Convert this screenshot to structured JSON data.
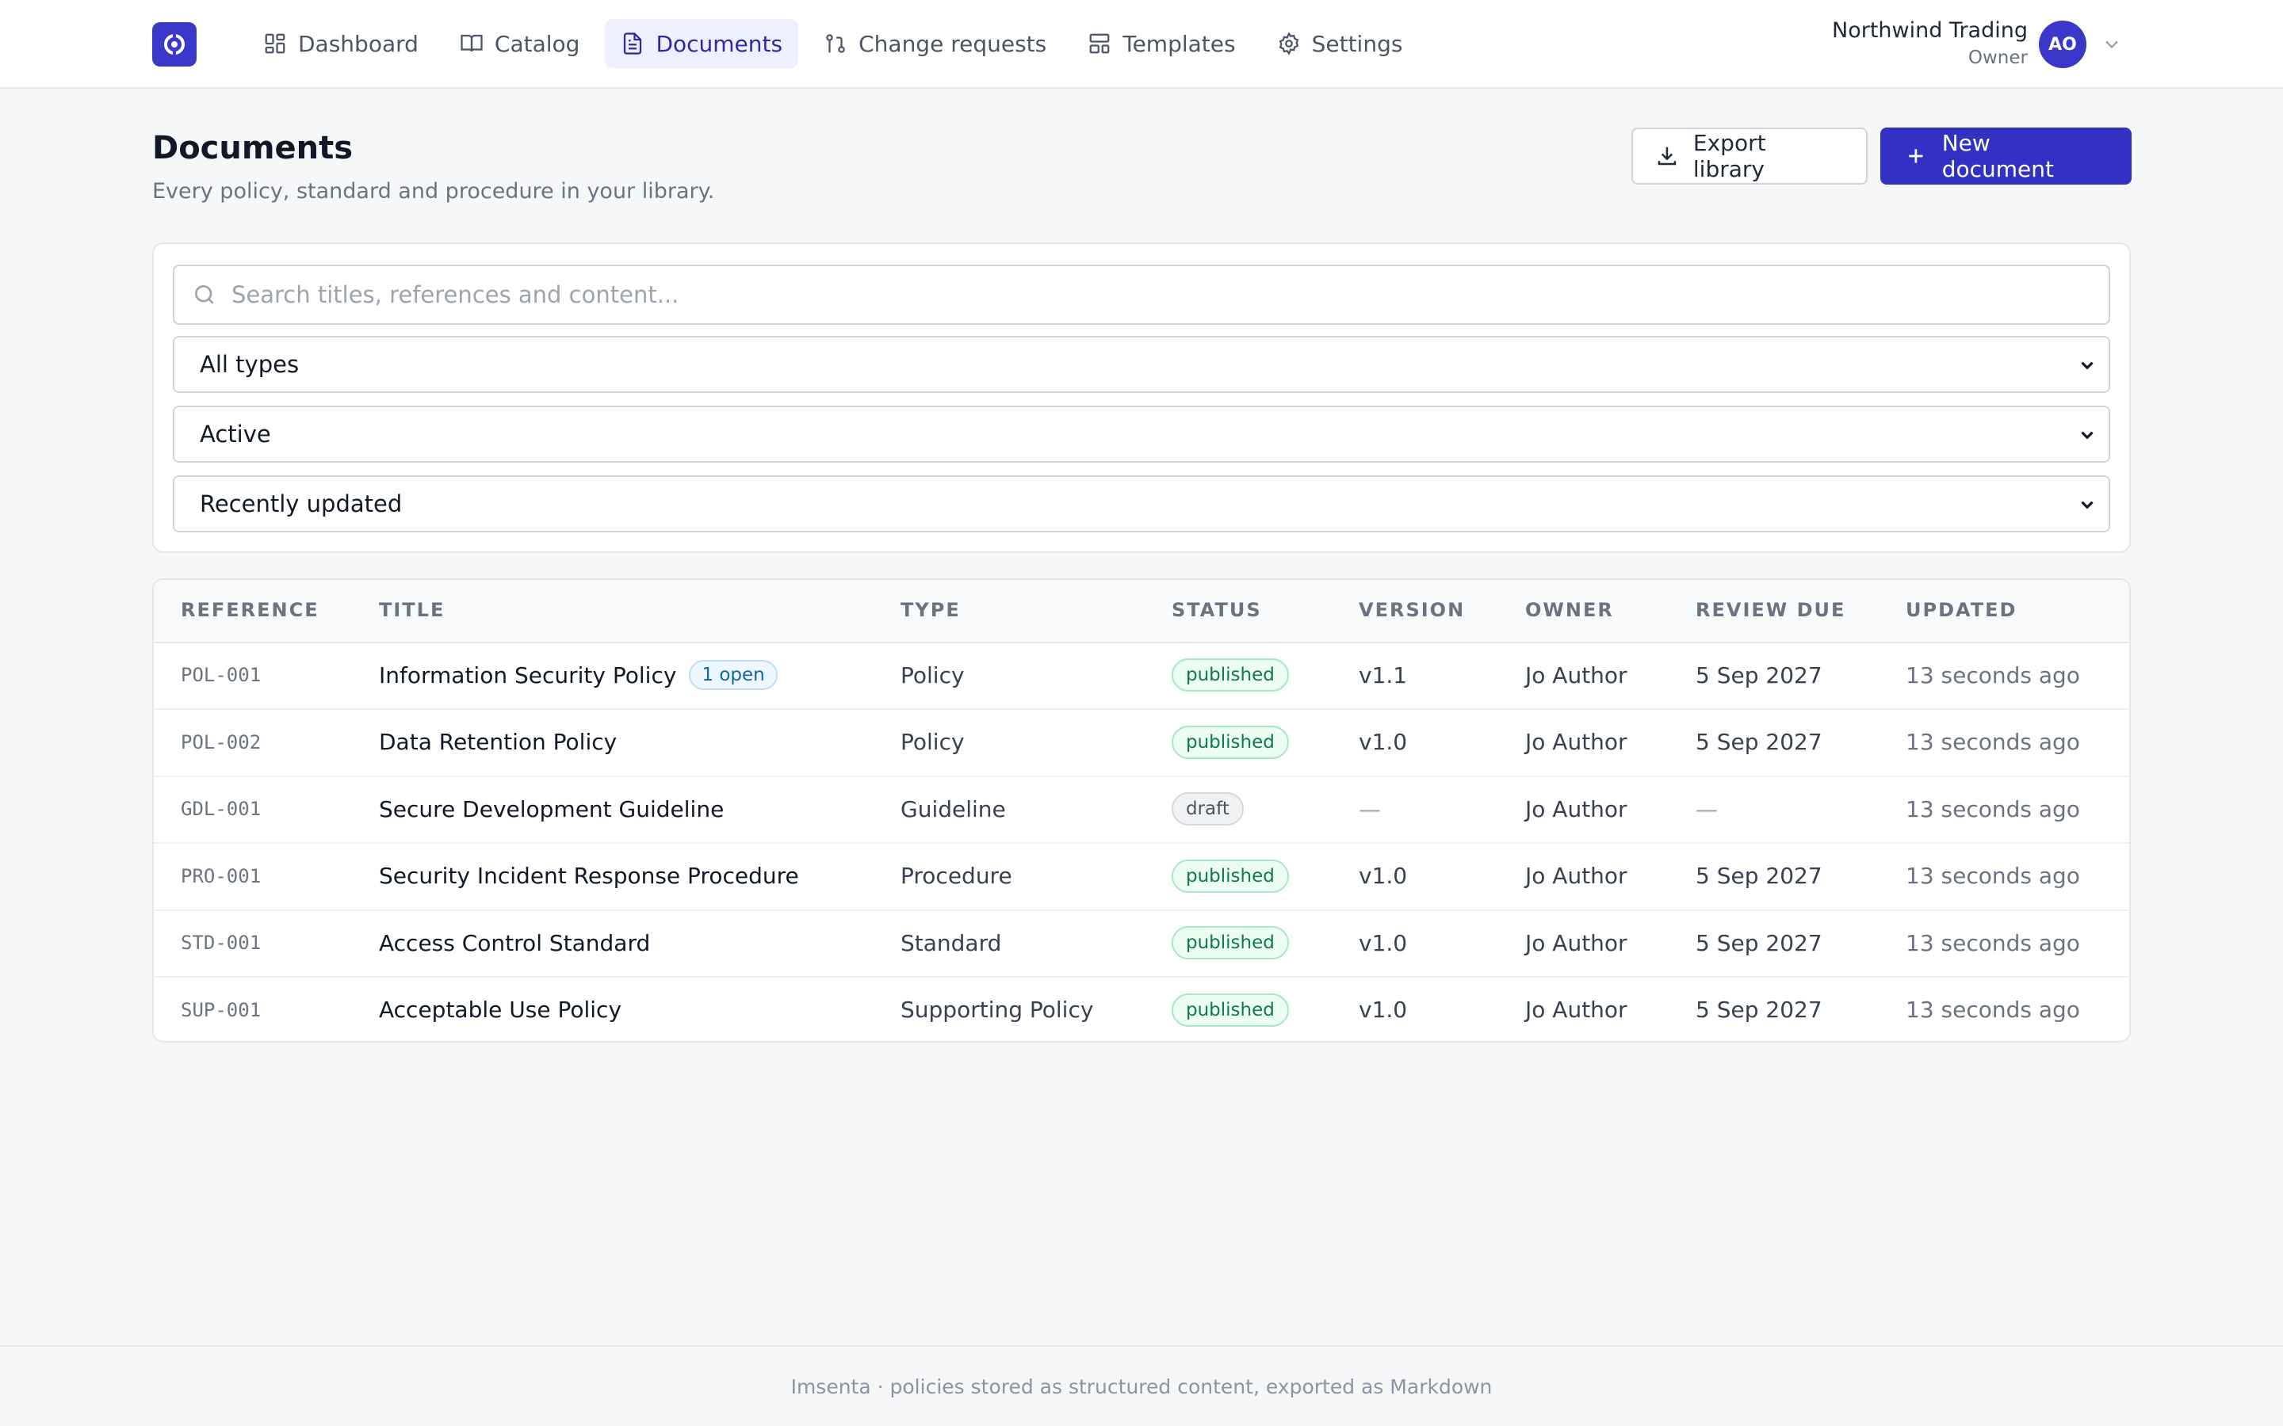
{
  "nav": {
    "items": [
      {
        "label": "Dashboard",
        "icon": "dashboard-icon"
      },
      {
        "label": "Catalog",
        "icon": "book-icon"
      },
      {
        "label": "Documents",
        "icon": "document-icon",
        "active": true
      },
      {
        "label": "Change requests",
        "icon": "git-pull-request-icon"
      },
      {
        "label": "Templates",
        "icon": "template-icon"
      },
      {
        "label": "Settings",
        "icon": "gear-icon"
      }
    ]
  },
  "account": {
    "org_name": "Northwind Trading",
    "role": "Owner",
    "initials": "AO"
  },
  "header": {
    "title": "Documents",
    "subtitle": "Every policy, standard and procedure in your library.",
    "export_label": "Export library",
    "new_label": "New document"
  },
  "filters": {
    "search_placeholder": "Search titles, references and content...",
    "type": "All types",
    "status": "Active",
    "sort": "Recently updated"
  },
  "table": {
    "headers": [
      "REFERENCE",
      "TITLE",
      "TYPE",
      "STATUS",
      "VERSION",
      "OWNER",
      "REVIEW DUE",
      "UPDATED"
    ],
    "rows": [
      {
        "reference": "POL-001",
        "title": "Information Security Policy",
        "badge": "1 open",
        "type": "Policy",
        "status": "published",
        "version": "v1.1",
        "owner": "Jo Author",
        "review_due": "5 Sep 2027",
        "updated": "13 seconds ago"
      },
      {
        "reference": "POL-002",
        "title": "Data Retention Policy",
        "badge": "",
        "type": "Policy",
        "status": "published",
        "version": "v1.0",
        "owner": "Jo Author",
        "review_due": "5 Sep 2027",
        "updated": "13 seconds ago"
      },
      {
        "reference": "GDL-001",
        "title": "Secure Development Guideline",
        "badge": "",
        "type": "Guideline",
        "status": "draft",
        "version": "—",
        "owner": "Jo Author",
        "review_due": "—",
        "updated": "13 seconds ago"
      },
      {
        "reference": "PRO-001",
        "title": "Security Incident Response Procedure",
        "badge": "",
        "type": "Procedure",
        "status": "published",
        "version": "v1.0",
        "owner": "Jo Author",
        "review_due": "5 Sep 2027",
        "updated": "13 seconds ago"
      },
      {
        "reference": "STD-001",
        "title": "Access Control Standard",
        "badge": "",
        "type": "Standard",
        "status": "published",
        "version": "v1.0",
        "owner": "Jo Author",
        "review_due": "5 Sep 2027",
        "updated": "13 seconds ago"
      },
      {
        "reference": "SUP-001",
        "title": "Acceptable Use Policy",
        "badge": "",
        "type": "Supporting Policy",
        "status": "published",
        "version": "v1.0",
        "owner": "Jo Author",
        "review_due": "5 Sep 2027",
        "updated": "13 seconds ago"
      }
    ]
  },
  "footer": {
    "text": "Imsenta · policies stored as structured content, exported as Markdown"
  },
  "colors": {
    "brand": "#3b37c9",
    "primary_button": "#3330c4",
    "published": "#0f7a4a",
    "draft": "#4b5563"
  }
}
